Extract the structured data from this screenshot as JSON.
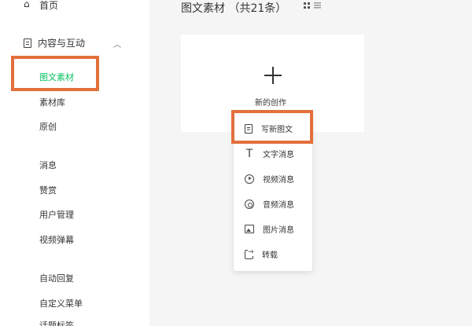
{
  "sidebar": {
    "home_label": "首页",
    "group_label": "内容与互动",
    "items": [
      {
        "label": "图文素材",
        "active": true
      },
      {
        "label": "素材库"
      },
      {
        "label": "原创"
      },
      {
        "label": "消息"
      },
      {
        "label": "赞赏"
      },
      {
        "label": "用户管理"
      },
      {
        "label": "视频弹幕"
      },
      {
        "label": "自动回复"
      },
      {
        "label": "自定义菜单"
      },
      {
        "label": "话题标签"
      }
    ]
  },
  "main": {
    "title": "图文素材 （共21条）",
    "new_card_label": "新的创作"
  },
  "create_menu": {
    "items": [
      {
        "label": "写新图文",
        "icon": "article-icon"
      },
      {
        "label": "文字消息",
        "icon": "text-icon"
      },
      {
        "label": "视频消息",
        "icon": "video-icon"
      },
      {
        "label": "音频消息",
        "icon": "audio-icon"
      },
      {
        "label": "图片消息",
        "icon": "image-icon"
      },
      {
        "label": "转载",
        "icon": "repost-icon"
      }
    ]
  },
  "colors": {
    "highlight": "#e26f3c",
    "active": "#07c160"
  }
}
